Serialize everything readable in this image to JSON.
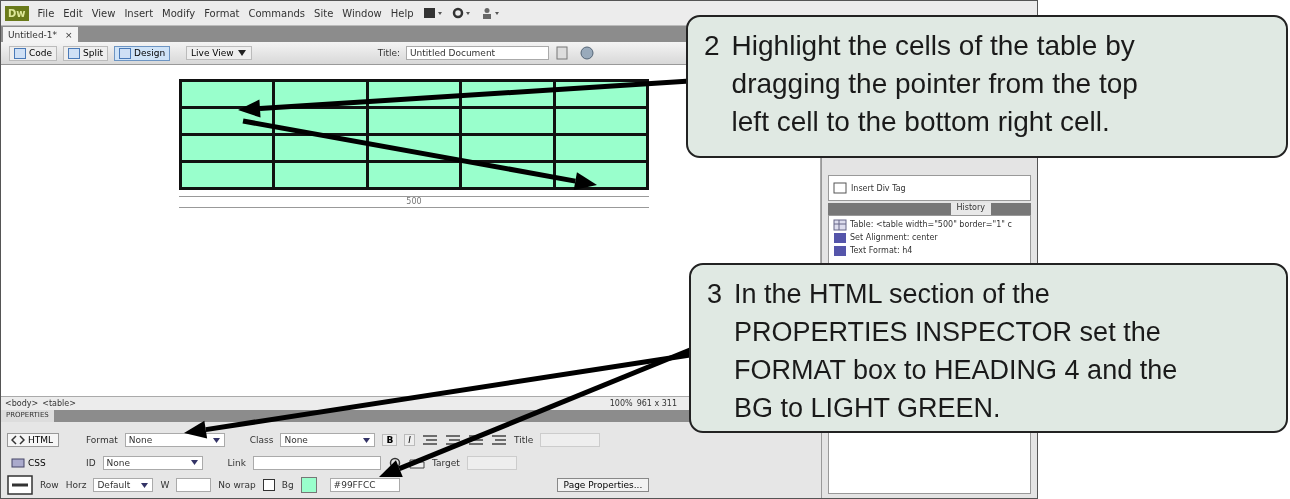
{
  "app_logo": "Dw",
  "menu": [
    "File",
    "Edit",
    "View",
    "Insert",
    "Modify",
    "Format",
    "Commands",
    "Site",
    "Window",
    "Help"
  ],
  "document_tab": {
    "label": "Untitled-1*",
    "close": "×"
  },
  "view_buttons": [
    {
      "label": "Code",
      "selected": false
    },
    {
      "label": "Split",
      "selected": false
    },
    {
      "label": "Design",
      "selected": true
    }
  ],
  "live_view": "Live View",
  "title_label": "Title:",
  "title_value": "Untitled Document",
  "design_table": {
    "rows": [
      {
        "cells": [
          {
            "kind": "empty"
          },
          {
            "kind": "empty"
          },
          {
            "kind": "empty"
          },
          {
            "kind": "empty"
          },
          {
            "kind": "empty"
          }
        ]
      },
      {
        "cells": [
          {
            "kind": "empty"
          },
          {
            "kind": "empty"
          },
          {
            "kind": "empty"
          },
          {
            "kind": "empty"
          },
          {
            "kind": "empty"
          }
        ]
      },
      {
        "cells": [
          {
            "kind": "empty"
          },
          {
            "kind": "empty"
          },
          {
            "kind": "empty"
          },
          {
            "kind": "empty"
          },
          {
            "kind": "empty"
          }
        ]
      },
      {
        "cells": [
          {
            "kind": "empty"
          },
          {
            "kind": "empty"
          },
          {
            "kind": "empty"
          },
          {
            "kind": "empty"
          },
          {
            "kind": "empty"
          }
        ]
      }
    ],
    "width_label": "500"
  },
  "status_bar": {
    "tags": [
      "<body>",
      "<table>"
    ],
    "zoom": "100%",
    "size": "961 x 311"
  },
  "properties": {
    "title": "PROPERTIES",
    "modes": [
      {
        "label": "HTML",
        "selected": true
      },
      {
        "label": "CSS",
        "selected": false
      }
    ],
    "format_label": "Format",
    "format_value": "None",
    "class_label": "Class",
    "class_value": "None",
    "bold": "B",
    "italic": "I",
    "title_label": "Title",
    "id_label": "ID",
    "id_value": "None",
    "link_label": "Link",
    "target_label": "Target",
    "row_label": "Row",
    "horz_label": "Horz",
    "horz_value": "Default",
    "w_label": "W",
    "nowrap_label": "No wrap",
    "nowrap_checked": false,
    "bg_label": "Bg",
    "bg_value": "#99FFCC",
    "page_properties": "Page Properties..."
  },
  "panel": {
    "insert_item": "Insert Div Tag",
    "tabs": [
      {
        "label": "History",
        "selected": true
      }
    ],
    "history": [
      "Table: <table width=\"500\" border=\"1\" c",
      "Set Alignment: center",
      "Text Format: h4"
    ]
  },
  "callouts": [
    {
      "number": "2",
      "text": "Highlight the cells of the table by\ndragging the pointer from the top\nleft cell to the bottom right cell."
    },
    {
      "number": "3",
      "text": "In the HTML section of the\nPROPERTIES INSPECTOR set the\nFORMAT box to HEADING 4 and the\nBG to LIGHT GREEN."
    }
  ]
}
